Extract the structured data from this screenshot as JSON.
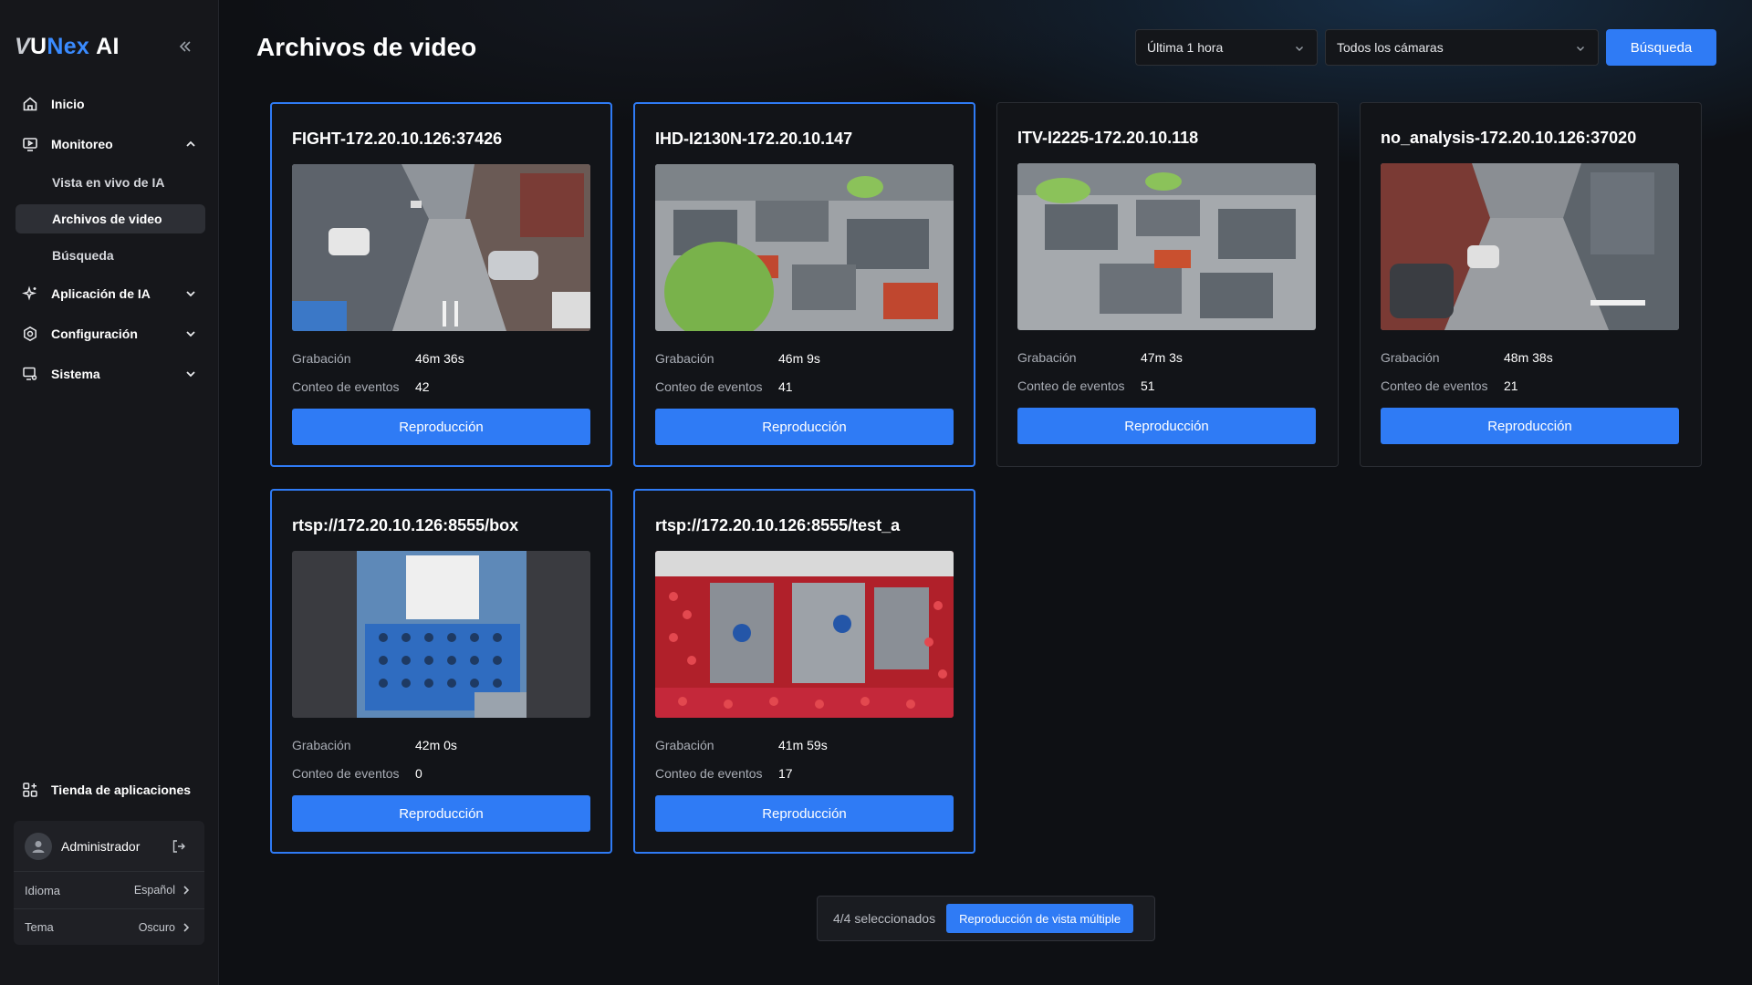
{
  "app": {
    "logo_v": "V",
    "logo_u": "U",
    "logo_nex": "Nex",
    "logo_rest": "AI"
  },
  "sidebar": {
    "items": [
      {
        "label": "Inicio",
        "icon": "home-icon"
      },
      {
        "label": "Monitoreo",
        "icon": "monitor-icon",
        "expanded": true,
        "children": [
          {
            "label": "Vista en vivo de IA",
            "active": false
          },
          {
            "label": "Archivos de video",
            "active": true
          },
          {
            "label": "Búsqueda",
            "active": false
          }
        ]
      },
      {
        "label": "Aplicación de IA",
        "icon": "sparkle-icon",
        "expanded": false
      },
      {
        "label": "Configuración",
        "icon": "gear-icon",
        "expanded": false
      },
      {
        "label": "Sistema",
        "icon": "system-icon",
        "expanded": false
      }
    ],
    "store_label": "Tienda de aplicaciones",
    "user": {
      "name": "Administrador"
    },
    "language": {
      "label": "Idioma",
      "value": "Español"
    },
    "theme": {
      "label": "Tema",
      "value": "Oscuro"
    }
  },
  "header": {
    "title": "Archivos de video",
    "time_filter": "Última 1 hora",
    "camera_filter": "Todos los cámaras",
    "search_label": "Búsqueda"
  },
  "cards": [
    {
      "title": "FIGHT-172.20.10.126:37426",
      "recording_label": "Grabación",
      "recording": "46m 36s",
      "events_label": "Conteo de eventos",
      "events": "42",
      "play_label": "Reproducción",
      "selected": true,
      "scene": "street"
    },
    {
      "title": "IHD-I2130N-172.20.10.147",
      "recording_label": "Grabación",
      "recording": "46m 9s",
      "events_label": "Conteo de eventos",
      "events": "41",
      "play_label": "Reproducción",
      "selected": true,
      "scene": "office-fisheye"
    },
    {
      "title": "ITV-I2225-172.20.10.118",
      "recording_label": "Grabación",
      "recording": "47m 3s",
      "events_label": "Conteo de eventos",
      "events": "51",
      "play_label": "Reproducción",
      "selected": false,
      "scene": "office"
    },
    {
      "title": "no_analysis-172.20.10.126:37020",
      "recording_label": "Grabación",
      "recording": "48m 38s",
      "events_label": "Conteo de eventos",
      "events": "21",
      "play_label": "Reproducción",
      "selected": false,
      "scene": "alley"
    },
    {
      "title": "rtsp://172.20.10.126:8555/box",
      "recording_label": "Grabación",
      "recording": "42m 0s",
      "events_label": "Conteo de eventos",
      "events": "0",
      "play_label": "Reproducción",
      "selected": true,
      "scene": "factory-box"
    },
    {
      "title": "rtsp://172.20.10.126:8555/test_a",
      "recording_label": "Grabación",
      "recording": "41m 59s",
      "events_label": "Conteo de eventos",
      "events": "17",
      "play_label": "Reproducción",
      "selected": true,
      "scene": "factory-apples"
    }
  ],
  "footer": {
    "selected_text": "4/4 seleccionados",
    "multi_play_label": "Reproducción de vista múltiple"
  },
  "colors": {
    "accent": "#2f7bf5",
    "background": "#0e1014",
    "sidebar": "#16171b"
  }
}
